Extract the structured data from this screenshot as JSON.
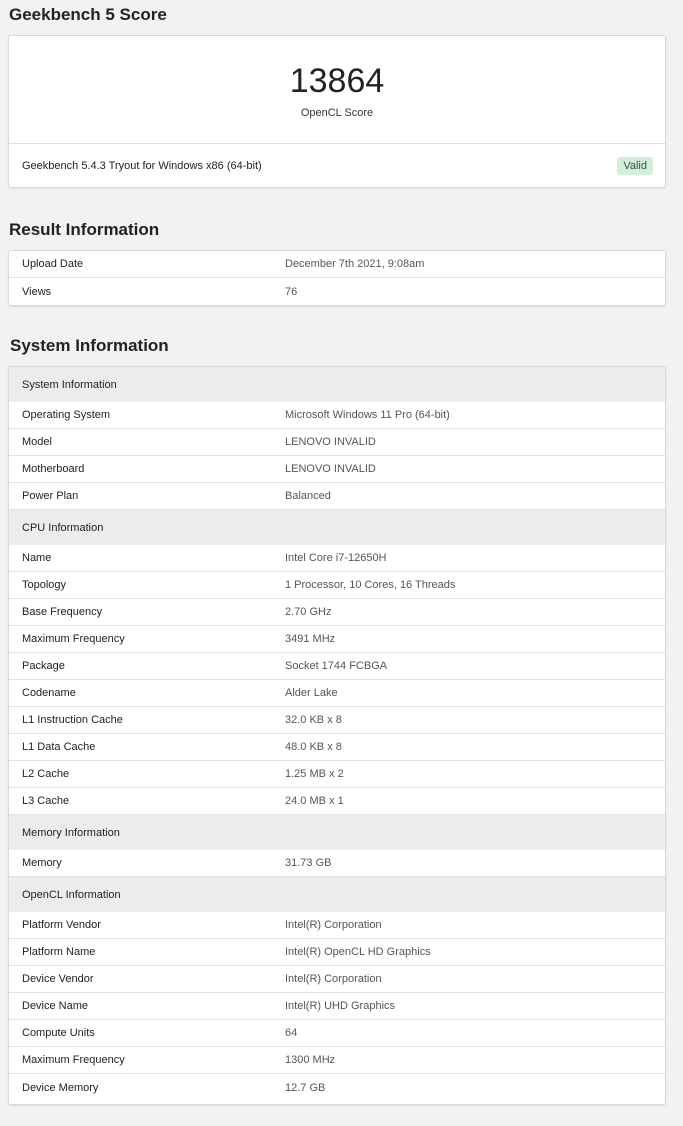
{
  "score_section": {
    "heading": "Geekbench 5 Score",
    "score": "13864",
    "score_label": "OpenCL Score",
    "version": "Geekbench 5.4.3 Tryout for Windows x86 (64-bit)",
    "status": "Valid"
  },
  "result_info": {
    "heading": "Result Information",
    "rows": [
      {
        "k": "Upload Date",
        "v": "December 7th 2021, 9:08am"
      },
      {
        "k": "Views",
        "v": "76"
      }
    ]
  },
  "system_info": {
    "heading": "System Information",
    "system": {
      "title": "System Information",
      "rows": [
        {
          "k": "Operating System",
          "v": "Microsoft Windows 11 Pro (64-bit)"
        },
        {
          "k": "Model",
          "v": "LENOVO INVALID"
        },
        {
          "k": "Motherboard",
          "v": "LENOVO INVALID"
        },
        {
          "k": "Power Plan",
          "v": "Balanced"
        }
      ]
    },
    "cpu": {
      "title": "CPU Information",
      "rows": [
        {
          "k": "Name",
          "v": "Intel Core i7-12650H"
        },
        {
          "k": "Topology",
          "v": "1 Processor, 10 Cores, 16 Threads"
        },
        {
          "k": "Base Frequency",
          "v": "2.70 GHz"
        },
        {
          "k": "Maximum Frequency",
          "v": "3491 MHz"
        },
        {
          "k": "Package",
          "v": "Socket 1744 FCBGA"
        },
        {
          "k": "Codename",
          "v": "Alder Lake"
        },
        {
          "k": "L1 Instruction Cache",
          "v": "32.0 KB x 8"
        },
        {
          "k": "L1 Data Cache",
          "v": "48.0 KB x 8"
        },
        {
          "k": "L2 Cache",
          "v": "1.25 MB x 2"
        },
        {
          "k": "L3 Cache",
          "v": "24.0 MB x 1"
        }
      ]
    },
    "memory": {
      "title": "Memory Information",
      "rows": [
        {
          "k": "Memory",
          "v": "31.73 GB"
        }
      ]
    },
    "opencl": {
      "title": "OpenCL Information",
      "rows": [
        {
          "k": "Platform Vendor",
          "v": "Intel(R) Corporation"
        },
        {
          "k": "Platform Name",
          "v": "Intel(R) OpenCL HD Graphics"
        },
        {
          "k": "Device Vendor",
          "v": "Intel(R) Corporation"
        },
        {
          "k": "Device Name",
          "v": "Intel(R) UHD Graphics"
        },
        {
          "k": "Compute Units",
          "v": "64"
        },
        {
          "k": "Maximum Frequency",
          "v": "1300 MHz"
        },
        {
          "k": "Device Memory",
          "v": "12.7 GB"
        }
      ]
    }
  }
}
